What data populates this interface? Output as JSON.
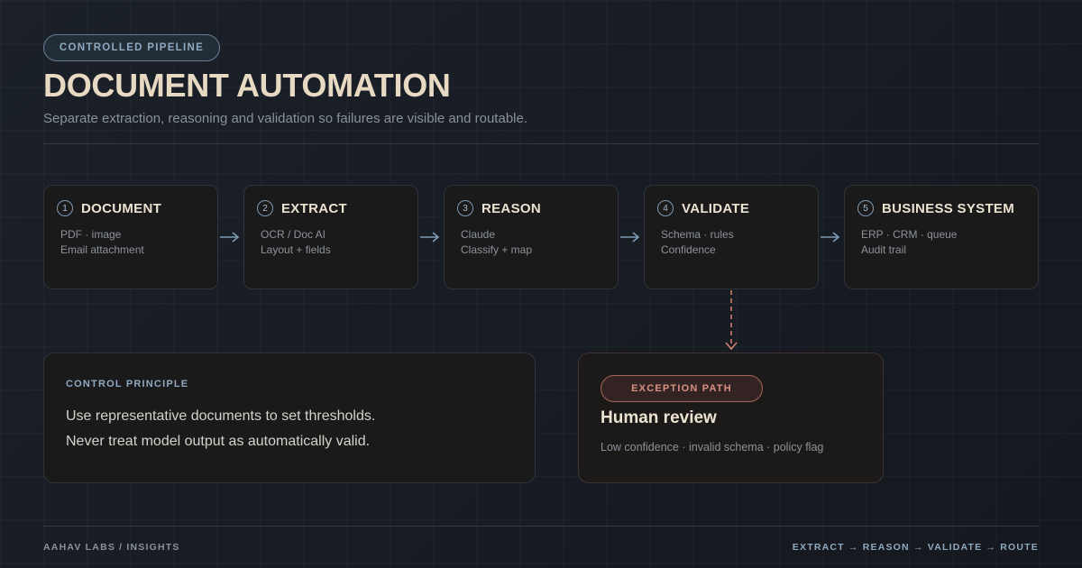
{
  "header": {
    "tag": "CONTROLLED PIPELINE",
    "title": "DOCUMENT AUTOMATION",
    "subtitle": "Separate extraction, reasoning and validation so failures are visible and routable."
  },
  "steps": [
    {
      "num": "1",
      "title": "DOCUMENT",
      "lines": [
        "PDF · image",
        "Email attachment"
      ]
    },
    {
      "num": "2",
      "title": "EXTRACT",
      "lines": [
        "OCR / Doc AI",
        "Layout + fields"
      ]
    },
    {
      "num": "3",
      "title": "REASON",
      "lines": [
        "Claude",
        "Classify + map"
      ]
    },
    {
      "num": "4",
      "title": "VALIDATE",
      "lines": [
        "Schema · rules",
        "Confidence"
      ]
    },
    {
      "num": "5",
      "title": "BUSINESS SYSTEM",
      "lines": [
        "ERP · CRM · queue",
        "Audit trail"
      ]
    }
  ],
  "principle": {
    "label": "CONTROL PRINCIPLE",
    "lines": [
      "Use representative documents to set thresholds.",
      "Never treat model output as automatically valid."
    ]
  },
  "exception": {
    "tag": "EXCEPTION PATH",
    "title": "Human review",
    "description": "Low confidence · invalid schema · policy flag"
  },
  "footer": {
    "left": "AAHAV LABS / INSIGHTS",
    "right": "EXTRACT → REASON → VALIDATE → ROUTE"
  },
  "colors": {
    "accent": "#8fa9c1",
    "title": "#e8d9c3",
    "exception": "#d99183",
    "background": "#181c22"
  }
}
